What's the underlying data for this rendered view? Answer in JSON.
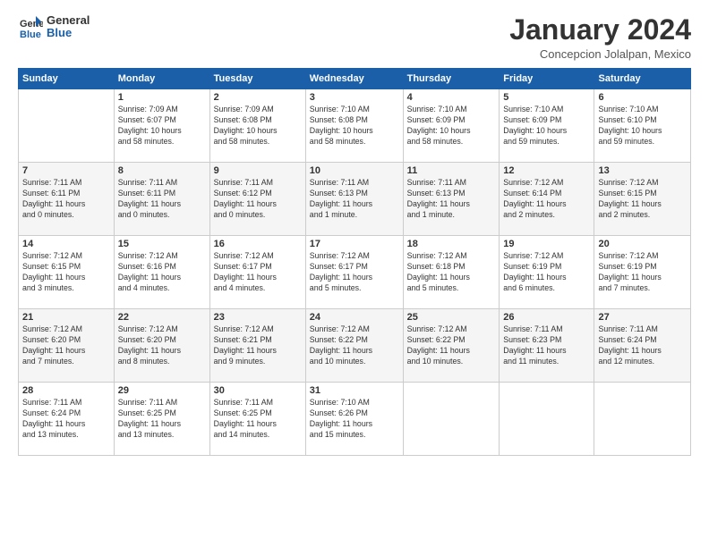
{
  "logo": {
    "line1": "General",
    "line2": "Blue"
  },
  "header": {
    "title": "January 2024",
    "subtitle": "Concepcion Jolalpan, Mexico"
  },
  "days_of_week": [
    "Sunday",
    "Monday",
    "Tuesday",
    "Wednesday",
    "Thursday",
    "Friday",
    "Saturday"
  ],
  "weeks": [
    [
      {
        "day": "",
        "info": ""
      },
      {
        "day": "1",
        "info": "Sunrise: 7:09 AM\nSunset: 6:07 PM\nDaylight: 10 hours\nand 58 minutes."
      },
      {
        "day": "2",
        "info": "Sunrise: 7:09 AM\nSunset: 6:08 PM\nDaylight: 10 hours\nand 58 minutes."
      },
      {
        "day": "3",
        "info": "Sunrise: 7:10 AM\nSunset: 6:08 PM\nDaylight: 10 hours\nand 58 minutes."
      },
      {
        "day": "4",
        "info": "Sunrise: 7:10 AM\nSunset: 6:09 PM\nDaylight: 10 hours\nand 58 minutes."
      },
      {
        "day": "5",
        "info": "Sunrise: 7:10 AM\nSunset: 6:09 PM\nDaylight: 10 hours\nand 59 minutes."
      },
      {
        "day": "6",
        "info": "Sunrise: 7:10 AM\nSunset: 6:10 PM\nDaylight: 10 hours\nand 59 minutes."
      }
    ],
    [
      {
        "day": "7",
        "info": "Sunrise: 7:11 AM\nSunset: 6:11 PM\nDaylight: 11 hours\nand 0 minutes."
      },
      {
        "day": "8",
        "info": "Sunrise: 7:11 AM\nSunset: 6:11 PM\nDaylight: 11 hours\nand 0 minutes."
      },
      {
        "day": "9",
        "info": "Sunrise: 7:11 AM\nSunset: 6:12 PM\nDaylight: 11 hours\nand 0 minutes."
      },
      {
        "day": "10",
        "info": "Sunrise: 7:11 AM\nSunset: 6:13 PM\nDaylight: 11 hours\nand 1 minute."
      },
      {
        "day": "11",
        "info": "Sunrise: 7:11 AM\nSunset: 6:13 PM\nDaylight: 11 hours\nand 1 minute."
      },
      {
        "day": "12",
        "info": "Sunrise: 7:12 AM\nSunset: 6:14 PM\nDaylight: 11 hours\nand 2 minutes."
      },
      {
        "day": "13",
        "info": "Sunrise: 7:12 AM\nSunset: 6:15 PM\nDaylight: 11 hours\nand 2 minutes."
      }
    ],
    [
      {
        "day": "14",
        "info": "Sunrise: 7:12 AM\nSunset: 6:15 PM\nDaylight: 11 hours\nand 3 minutes."
      },
      {
        "day": "15",
        "info": "Sunrise: 7:12 AM\nSunset: 6:16 PM\nDaylight: 11 hours\nand 4 minutes."
      },
      {
        "day": "16",
        "info": "Sunrise: 7:12 AM\nSunset: 6:17 PM\nDaylight: 11 hours\nand 4 minutes."
      },
      {
        "day": "17",
        "info": "Sunrise: 7:12 AM\nSunset: 6:17 PM\nDaylight: 11 hours\nand 5 minutes."
      },
      {
        "day": "18",
        "info": "Sunrise: 7:12 AM\nSunset: 6:18 PM\nDaylight: 11 hours\nand 5 minutes."
      },
      {
        "day": "19",
        "info": "Sunrise: 7:12 AM\nSunset: 6:19 PM\nDaylight: 11 hours\nand 6 minutes."
      },
      {
        "day": "20",
        "info": "Sunrise: 7:12 AM\nSunset: 6:19 PM\nDaylight: 11 hours\nand 7 minutes."
      }
    ],
    [
      {
        "day": "21",
        "info": "Sunrise: 7:12 AM\nSunset: 6:20 PM\nDaylight: 11 hours\nand 7 minutes."
      },
      {
        "day": "22",
        "info": "Sunrise: 7:12 AM\nSunset: 6:20 PM\nDaylight: 11 hours\nand 8 minutes."
      },
      {
        "day": "23",
        "info": "Sunrise: 7:12 AM\nSunset: 6:21 PM\nDaylight: 11 hours\nand 9 minutes."
      },
      {
        "day": "24",
        "info": "Sunrise: 7:12 AM\nSunset: 6:22 PM\nDaylight: 11 hours\nand 10 minutes."
      },
      {
        "day": "25",
        "info": "Sunrise: 7:12 AM\nSunset: 6:22 PM\nDaylight: 11 hours\nand 10 minutes."
      },
      {
        "day": "26",
        "info": "Sunrise: 7:11 AM\nSunset: 6:23 PM\nDaylight: 11 hours\nand 11 minutes."
      },
      {
        "day": "27",
        "info": "Sunrise: 7:11 AM\nSunset: 6:24 PM\nDaylight: 11 hours\nand 12 minutes."
      }
    ],
    [
      {
        "day": "28",
        "info": "Sunrise: 7:11 AM\nSunset: 6:24 PM\nDaylight: 11 hours\nand 13 minutes."
      },
      {
        "day": "29",
        "info": "Sunrise: 7:11 AM\nSunset: 6:25 PM\nDaylight: 11 hours\nand 13 minutes."
      },
      {
        "day": "30",
        "info": "Sunrise: 7:11 AM\nSunset: 6:25 PM\nDaylight: 11 hours\nand 14 minutes."
      },
      {
        "day": "31",
        "info": "Sunrise: 7:10 AM\nSunset: 6:26 PM\nDaylight: 11 hours\nand 15 minutes."
      },
      {
        "day": "",
        "info": ""
      },
      {
        "day": "",
        "info": ""
      },
      {
        "day": "",
        "info": ""
      }
    ]
  ]
}
